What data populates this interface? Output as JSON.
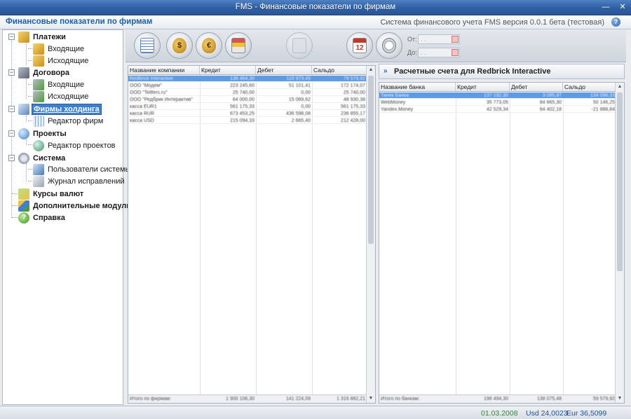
{
  "window": {
    "title": "FMS - Финансовые показатели по фирмам"
  },
  "header": {
    "page_title": "Финансовые показатели по фирмам",
    "version": "Система финансового учета FMS версия 0.0.1 бета (тестовая)"
  },
  "sidebar": {
    "payments": {
      "label": "Платежи",
      "incoming": "Входящие",
      "outgoing": "Исходящие"
    },
    "contracts": {
      "label": "Договора",
      "incoming": "Входящие",
      "outgoing": "Исходящие"
    },
    "holding": {
      "label": "Фирмы холдинга",
      "editor": "Редактор фирм"
    },
    "projects": {
      "label": "Проекты",
      "editor": "Редактор проектов"
    },
    "system": {
      "label": "Система",
      "users": "Пользователи системы",
      "journal": "Журнал исправлений"
    },
    "currency": {
      "label": "Курсы валют"
    },
    "modules": {
      "label": "Дополнительные модули"
    },
    "help": {
      "label": "Справка"
    }
  },
  "toolbar": {
    "date_from_label": "От:",
    "date_to_label": "До:",
    "date_from_value": " .  .",
    "date_to_value": " .  ."
  },
  "companies": {
    "headers": [
      "Название компании",
      "Кредит",
      "Дебет",
      "Сальдо"
    ],
    "rows": [
      [
        "Redbrick Interactive",
        "138 464,30",
        "118 973,45",
        "79 579,92"
      ],
      [
        "ООО \"Модем\"",
        "223 245,60",
        "51 101,41",
        "172 174,07"
      ],
      [
        "ООО \"Tellfers.ru\"",
        "25 740,00",
        "0,00",
        "25 740,00"
      ],
      [
        "ООО \"Редбрик Интерактив\"",
        "64 000,00",
        "15 069,62",
        "48 930,38"
      ],
      [
        "касса EUR1",
        "561 175,33",
        "0,00",
        "561 175,33"
      ],
      [
        "касса RUR",
        "673 453,25",
        "436 598,08",
        "236 855,17"
      ],
      [
        "касса USD",
        "215 094,33",
        "2 665,40",
        "212 428,00"
      ]
    ],
    "footer": [
      "Итого по фирмам:",
      "1 900 106,30",
      "141 224,09",
      "1 316 882,21"
    ]
  },
  "accounts": {
    "title": "Расчетные счета для Redbrick Interactive",
    "headers": [
      "Название банка",
      "Кредит",
      "Дебет",
      "Сальдо"
    ],
    "rows": [
      [
        "Тинек Банка",
        "137 192,30",
        "3 095,97",
        "134 096,33"
      ],
      [
        "WebMoney",
        "35 773,05",
        "84 665,30",
        "50 146,25"
      ],
      [
        "Yandex.Money",
        "42 529,34",
        "64 402,18",
        "-21 888,84"
      ]
    ],
    "footer": [
      "Итого по банкам:",
      "198 494,30",
      "138 075,48",
      "59 579,92"
    ]
  },
  "status": {
    "date": "01.03.2008",
    "usd": "Usd 24,0023",
    "eur": "Eur 36,5099"
  }
}
